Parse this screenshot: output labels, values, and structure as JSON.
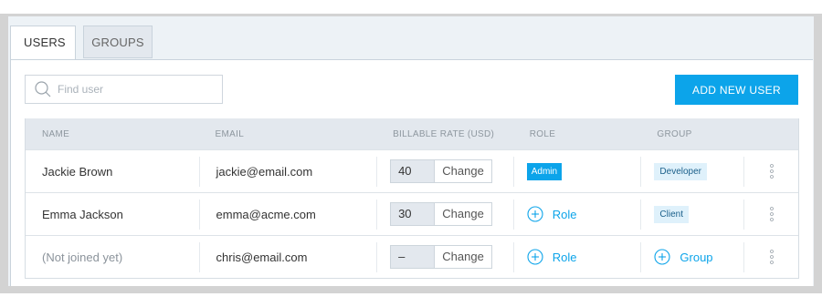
{
  "tabs": [
    {
      "label": "USERS",
      "active": true
    },
    {
      "label": "GROUPS",
      "active": false
    }
  ],
  "search": {
    "placeholder": "Find user",
    "value": "",
    "icon": "search-icon"
  },
  "add_button": {
    "label": "ADD NEW USER"
  },
  "table": {
    "columns": [
      "NAME",
      "EMAIL",
      "BILLABLE RATE (USD)",
      "ROLE",
      "GROUP"
    ],
    "rows": [
      {
        "name": "Jackie Brown",
        "email": "jackie@email.com",
        "rate": "40",
        "change": "Change",
        "role": "Admin",
        "group": "Developer"
      },
      {
        "name": "Emma Jackson",
        "email": "emma@acme.com",
        "rate": "30",
        "change": "Change",
        "role_action": "Role",
        "group": "Client"
      },
      {
        "name": "(Not joined yet)",
        "email": "chris@email.com",
        "rate": "–",
        "change": "Change",
        "role_action": "Role",
        "group_action": "Group"
      }
    ]
  },
  "colors": {
    "accent": "#0ca4ea",
    "header_bg": "#e3e8ee",
    "frame": "#d3d3d3",
    "badge_light": "#dff1fb"
  }
}
